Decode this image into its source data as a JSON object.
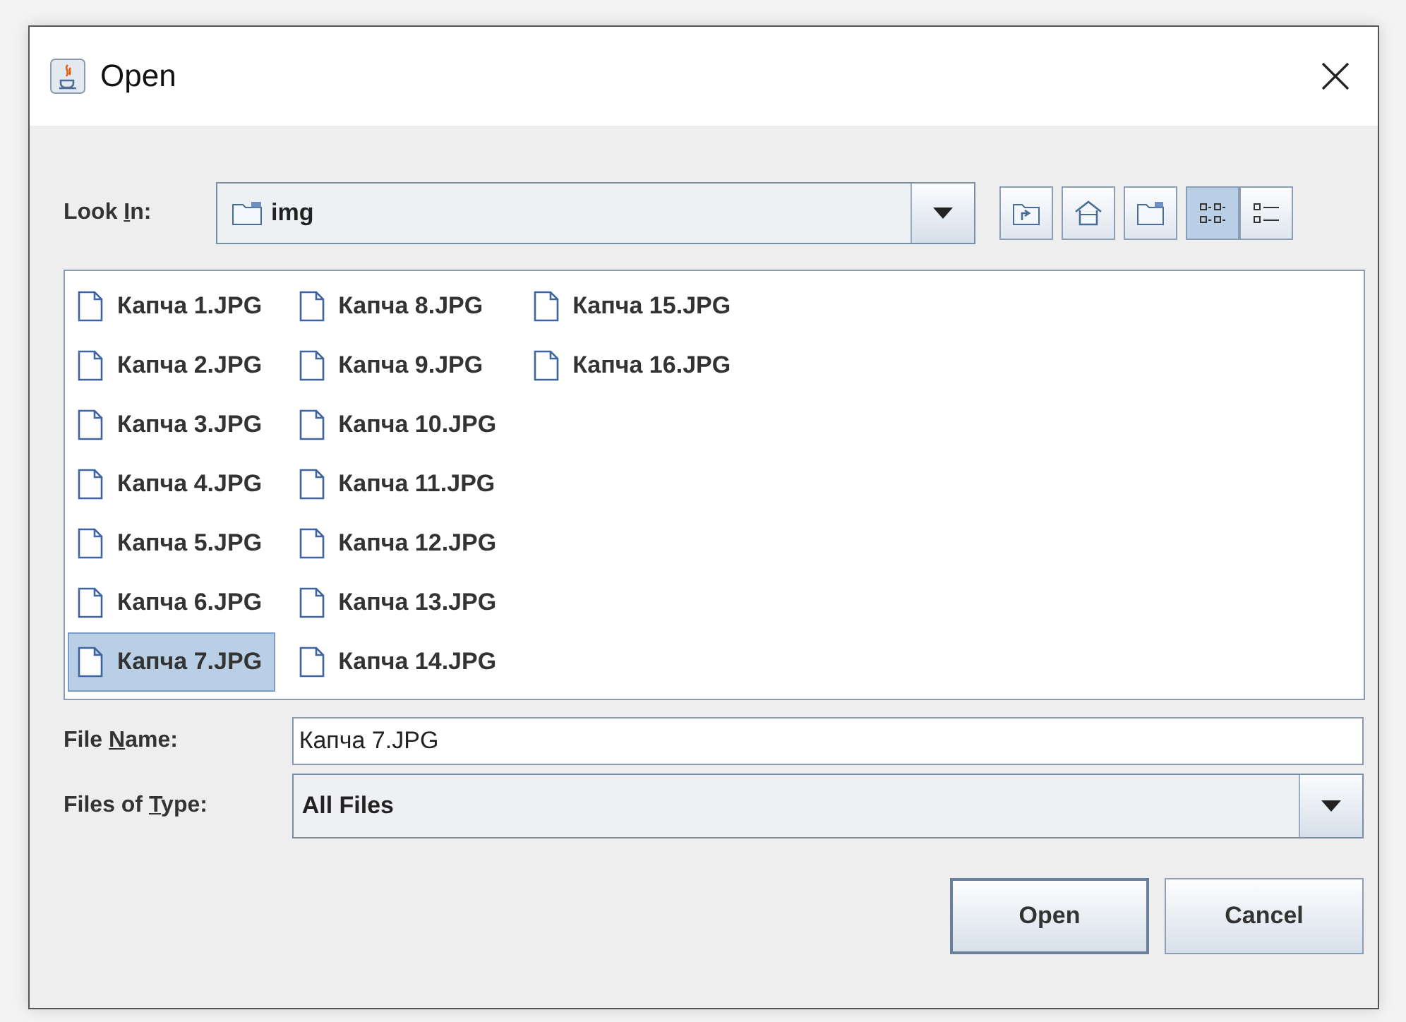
{
  "window": {
    "title": "Open"
  },
  "look_in": {
    "label": [
      "Look ",
      "I",
      "n:"
    ],
    "value": "img"
  },
  "toolbar": [
    {
      "kind": "up-folder"
    },
    {
      "kind": "home"
    },
    {
      "kind": "new-folder"
    }
  ],
  "view_toggle": [
    {
      "kind": "list",
      "selected": true
    },
    {
      "kind": "details",
      "selected": false
    }
  ],
  "files": [
    {
      "name": "Капча 1.JPG",
      "selected": false
    },
    {
      "name": "Капча 2.JPG",
      "selected": false
    },
    {
      "name": "Капча 3.JPG",
      "selected": false
    },
    {
      "name": "Капча 4.JPG",
      "selected": false
    },
    {
      "name": "Капча 5.JPG",
      "selected": false
    },
    {
      "name": "Капча 6.JPG",
      "selected": false
    },
    {
      "name": "Капча 7.JPG",
      "selected": true
    },
    {
      "name": "Капча 8.JPG",
      "selected": false
    },
    {
      "name": "Капча 9.JPG",
      "selected": false
    },
    {
      "name": "Капча 10.JPG",
      "selected": false
    },
    {
      "name": "Капча 11.JPG",
      "selected": false
    },
    {
      "name": "Капча 12.JPG",
      "selected": false
    },
    {
      "name": "Капча 13.JPG",
      "selected": false
    },
    {
      "name": "Капча 14.JPG",
      "selected": false
    },
    {
      "name": "Капча 15.JPG",
      "selected": false
    },
    {
      "name": "Капча 16.JPG",
      "selected": false
    }
  ],
  "file_name": {
    "label": [
      "File ",
      "N",
      "ame:"
    ],
    "value": "Капча 7.JPG"
  },
  "files_of_type": {
    "label": [
      "Files of ",
      "T",
      "ype:"
    ],
    "value": "All Files"
  },
  "buttons": [
    {
      "label": "Open",
      "kind": "default"
    },
    {
      "label": "Cancel",
      "kind": "normal"
    }
  ]
}
